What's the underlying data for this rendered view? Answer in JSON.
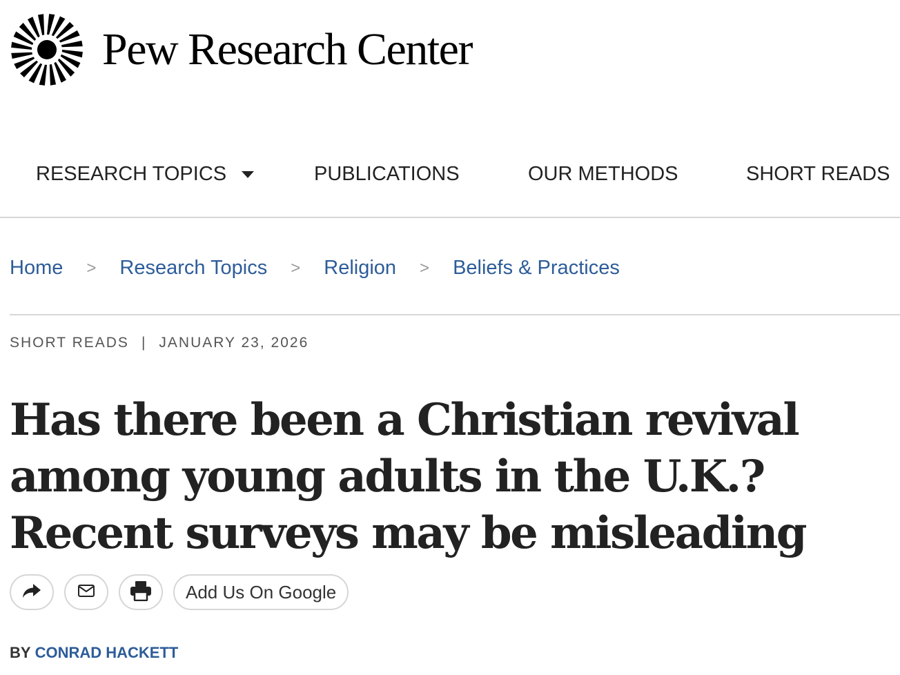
{
  "brand": {
    "name": "Pew Research Center",
    "logo_icon": "sunburst-logo-icon"
  },
  "nav": {
    "items": [
      {
        "label": "RESEARCH TOPICS",
        "has_dropdown": true
      },
      {
        "label": "PUBLICATIONS"
      },
      {
        "label": "OUR METHODS"
      },
      {
        "label": "SHORT READS"
      }
    ]
  },
  "breadcrumb": {
    "items": [
      "Home",
      "Research Topics",
      "Religion",
      "Beliefs & Practices"
    ],
    "separator": ">"
  },
  "article": {
    "category": "SHORT READS",
    "meta_separator": "|",
    "date": "JANUARY 23, 2026",
    "headline": "Has there been a Christian revival among young adults in the U.K.? Recent surveys may be misleading",
    "byline_prefix": "BY",
    "author": "CONRAD HACKETT"
  },
  "share": {
    "buttons": [
      {
        "icon": "share-arrow-icon"
      },
      {
        "icon": "envelope-icon"
      },
      {
        "icon": "printer-icon"
      }
    ],
    "google_label": "Add Us On Google"
  },
  "colors": {
    "link": "#2d5c99",
    "text": "#222222",
    "divider": "#d6d6d6"
  }
}
